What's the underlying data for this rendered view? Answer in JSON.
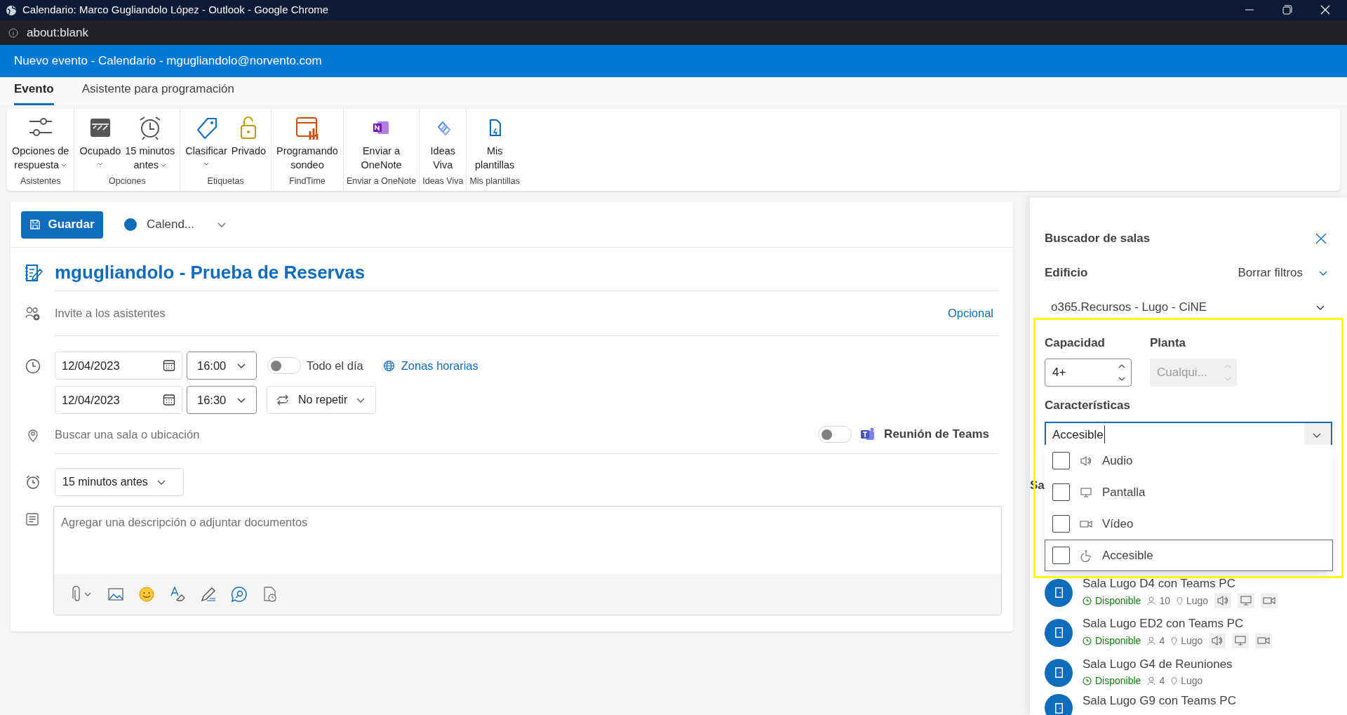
{
  "window": {
    "title": "Calendario: Marco Gugliandolo López - Outlook - Google Chrome",
    "address": "about:blank"
  },
  "header": {
    "title": "Nuevo evento - Calendario - mgugliandolo@norvento.com"
  },
  "tabs": [
    {
      "label": "Evento",
      "selected": true
    },
    {
      "label": "Asistente para programación",
      "selected": false
    }
  ],
  "ribbon": [
    {
      "group": "Asistentes",
      "buttons": [
        {
          "label": "Opciones de\nrespuesta",
          "has_menu": true
        }
      ]
    },
    {
      "group": "Opciones",
      "buttons": [
        {
          "label": "Ocupado",
          "has_menu": true
        },
        {
          "label": "15 minutos\nantes",
          "has_menu": true
        }
      ]
    },
    {
      "group": "Etiquetas",
      "buttons": [
        {
          "label": "Clasificar",
          "has_menu": true
        },
        {
          "label": "Privado",
          "has_menu": false
        }
      ]
    },
    {
      "group": "FindTime",
      "buttons": [
        {
          "label": "Programando\nsondeo",
          "has_menu": false
        }
      ]
    },
    {
      "group": "Enviar a OneNote",
      "buttons": [
        {
          "label": "Enviar a\nOneNote",
          "has_menu": false
        }
      ]
    },
    {
      "group": "Ideas Viva",
      "buttons": [
        {
          "label": "Ideas\nViva",
          "has_menu": false
        }
      ]
    },
    {
      "group": "Mis plantillas",
      "buttons": [
        {
          "label": "Mis\nplantillas",
          "has_menu": false
        }
      ]
    }
  ],
  "event": {
    "save": "Guardar",
    "calendar": {
      "label": "Calend...",
      "color": "#0f6cbd"
    },
    "title": "mgugliandolo - Prueba de Reservas",
    "attendees": {
      "placeholder": "Invite a los asistentes",
      "optional": "Opcional"
    },
    "start": {
      "date": "12/04/2023",
      "time": "16:00"
    },
    "end": {
      "date": "12/04/2023",
      "time": "16:30"
    },
    "all_day": {
      "label": "Todo el día",
      "on": false
    },
    "time_zones": "Zonas horarias",
    "repeat": "No repetir",
    "location": {
      "placeholder": "Buscar una sala o ubicación"
    },
    "teams": {
      "label": "Reunión de Teams",
      "on": false
    },
    "reminder": "15 minutos antes",
    "description": {
      "placeholder": "Agregar una descripción o adjuntar documentos"
    }
  },
  "room_finder": {
    "title": "Buscador de salas",
    "building_label": "Edificio",
    "clear_filters": "Borrar filtros",
    "building": "o365.Recursos - Lugo - CiNE",
    "capacity_label": "Capacidad",
    "capacity": "4+",
    "floor_label": "Planta",
    "floor": {
      "placeholder": "Cualqui...",
      "disabled": true
    },
    "features_label": "Características",
    "features_value": "Accesible",
    "options": [
      {
        "kind": "audio",
        "label": "Audio",
        "checked": false,
        "highlighted": false
      },
      {
        "kind": "display",
        "label": "Pantalla",
        "checked": false,
        "highlighted": false
      },
      {
        "kind": "video",
        "label": "Vídeo",
        "checked": false,
        "highlighted": false
      },
      {
        "kind": "accessible",
        "label": "Accesible",
        "checked": false,
        "highlighted": true
      }
    ],
    "list_heading": "Sa",
    "rooms": [
      {
        "name": "Sala Lugo D4 con Teams PC",
        "status": "Disponible",
        "capacity": "10",
        "location": "Lugo",
        "audio": true,
        "display": true,
        "video": true
      },
      {
        "name": "Sala Lugo ED2 con Teams PC",
        "status": "Disponible",
        "capacity": "4",
        "location": "Lugo",
        "audio": true,
        "display": true,
        "video": true
      },
      {
        "name": "Sala Lugo G4 de Reuniones",
        "status": "Disponible",
        "capacity": "4",
        "location": "Lugo"
      },
      {
        "name": "Sala Lugo G9 con Teams PC"
      }
    ]
  }
}
